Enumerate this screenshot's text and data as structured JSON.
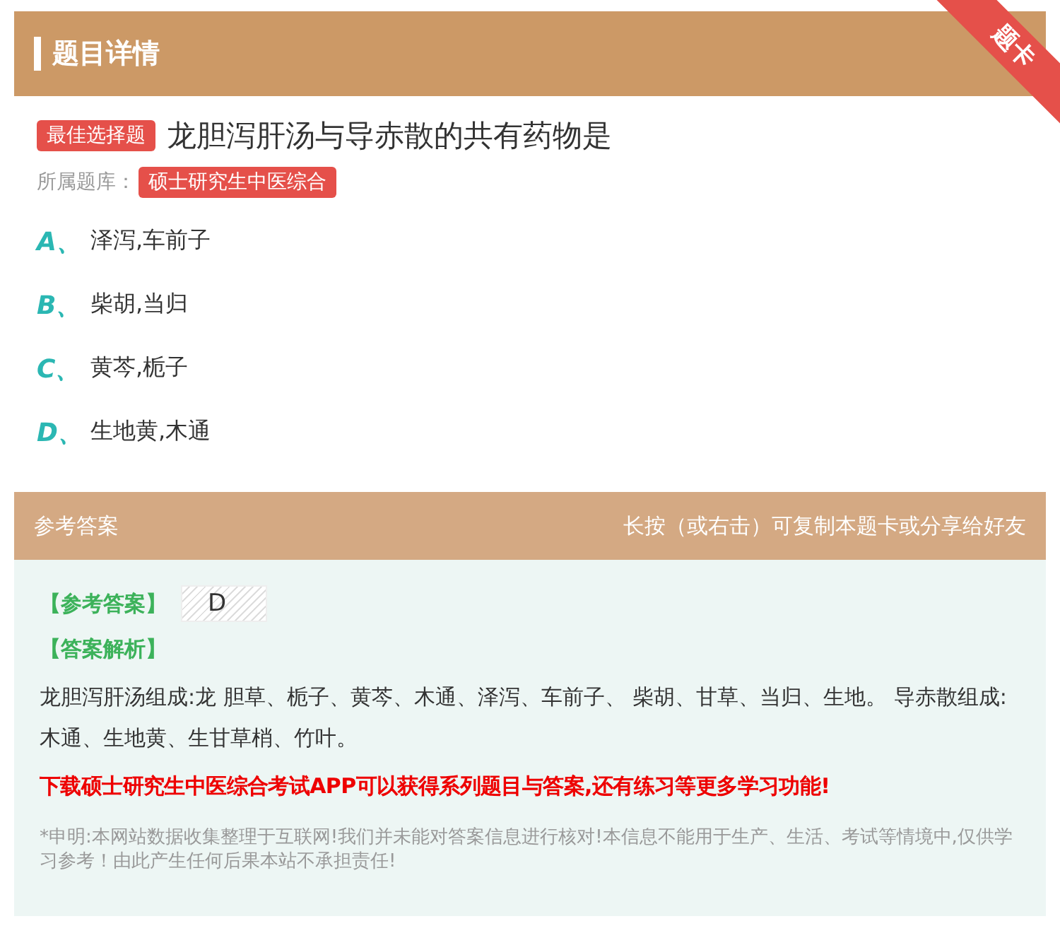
{
  "header": {
    "title": "题目详情",
    "corner_badge": "题卡"
  },
  "question": {
    "type_tag": "最佳选择题",
    "text": "龙胆泻肝汤与导赤散的共有药物是",
    "library_label": "所属题库：",
    "library": "硕士研究生中医综合"
  },
  "options": [
    {
      "letter": "A、",
      "text": "泽泻,车前子"
    },
    {
      "letter": "B、",
      "text": "柴胡,当归"
    },
    {
      "letter": "C、",
      "text": "黄芩,栀子"
    },
    {
      "letter": "D、",
      "text": "生地黄,木通"
    }
  ],
  "answer": {
    "title": "参考答案",
    "hint": "长按（或右击）可复制本题卡或分享给好友",
    "answer_label": "【参考答案】",
    "answer_value": "D",
    "analysis_label": "【答案解析】",
    "analysis": "龙胆泻肝汤组成:龙 胆草、栀子、黄芩、木通、泽泻、车前子、 柴胡、甘草、当归、生地。 导赤散组成:木通、生地黄、生甘草梢、竹叶。",
    "promo": "下载硕士研究生中医综合考试APP可以获得系列题目与答案,还有练习等更多学习功能!",
    "disclaimer": "*申明:本网站数据收集整理于互联网!我们并未能对答案信息进行核对!本信息不能用于生产、生活、考试等情境中,仅供学习参考！由此产生任何后果本站不承担责任!"
  }
}
